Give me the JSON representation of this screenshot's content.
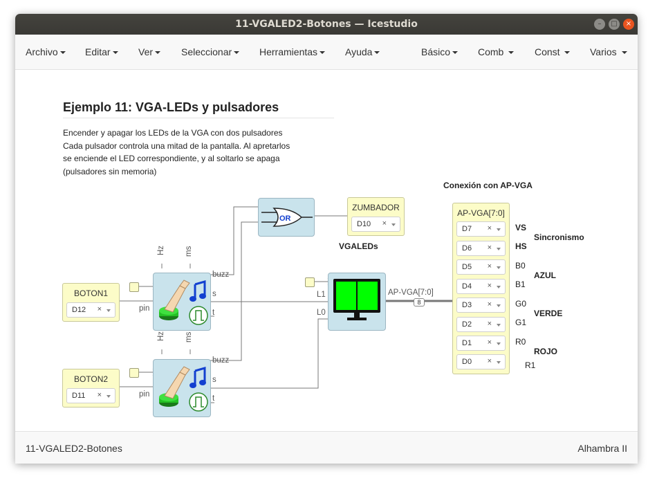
{
  "window": {
    "title": "11-VGALED2-Botones — Icestudio"
  },
  "menu": {
    "left": [
      "Archivo",
      "Editar",
      "Ver",
      "Seleccionar",
      "Herramientas",
      "Ayuda"
    ],
    "right": [
      "Básico",
      "Comb",
      "Const",
      "Varios"
    ]
  },
  "diagram": {
    "heading": "Ejemplo 11: VGA-LEDs y pulsadores",
    "description": [
      "Encender y apagar los LEDs de la VGA con dos pulsadores",
      "Cada pulsador controla una mitad de la pantalla. Al apretarlos",
      "se enciende el LED correspondiente, y al soltarlo se apaga",
      "(pulsadores sin memoria)"
    ],
    "boton1": {
      "title": "BOTON1",
      "pin": "D12"
    },
    "boton2": {
      "title": "BOTON2",
      "pin": "D11"
    },
    "zumbador": {
      "title": "ZUMBADOR",
      "pin": "D10"
    },
    "or_label": "OR",
    "vgaleds_label": "VGALEDs",
    "apvga": {
      "title": "AP-VGA[7:0]",
      "pins": [
        "D7",
        "D6",
        "D5",
        "D4",
        "D3",
        "D2",
        "D1",
        "D0"
      ]
    },
    "bus_label": "AP-VGA[7:0]",
    "bus_width": "8",
    "conexion_label": "Conexión con AP-VGA",
    "signals": [
      "VS",
      "HS",
      "B0",
      "B1",
      "G0",
      "G1",
      "R0",
      "R1"
    ],
    "groups": {
      "sync": "Sincronismo",
      "blue": "AZUL",
      "green": "VERDE",
      "red": "ROJO"
    },
    "ports": {
      "hz": "Hz",
      "ms": "ms",
      "buzz": "buzz",
      "s": "s",
      "t": "t",
      "pin": "pin",
      "l1": "L1",
      "l0": "L0"
    },
    "remove_symbol": "×"
  },
  "status": {
    "left": "11-VGALED2-Botones",
    "right": "Alhambra II"
  },
  "colors": {
    "block": "#c9e3ec",
    "pin": "#fcfcc8",
    "screen": "#00ff00",
    "accent_close": "#e95420"
  },
  "icons": [
    "minimize-icon",
    "maximize-icon",
    "close-icon",
    "or-gate-icon",
    "monitor-icon",
    "finger-button-icon",
    "music-note-icon",
    "pulse-icon"
  ]
}
